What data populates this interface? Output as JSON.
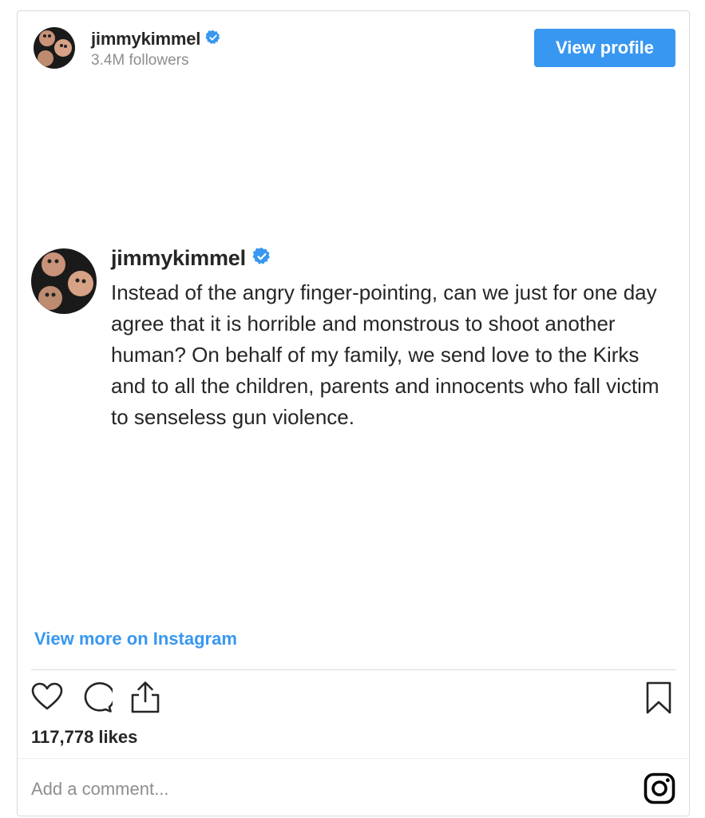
{
  "header": {
    "username": "jimmykimmel",
    "followers": "3.4M followers",
    "view_profile_label": "View profile"
  },
  "post": {
    "username": "jimmykimmel",
    "caption": "Instead of the angry finger-pointing, can we just for one day agree that it is horrible and monstrous to shoot another human? On behalf of my family, we send love to the Kirks and to all the children, parents and innocents who fall victim to senseless gun violence.",
    "view_more_label": "View more on Instagram"
  },
  "actions": {
    "icons": [
      "heart-icon",
      "comment-icon",
      "share-icon",
      "bookmark-icon"
    ],
    "likes": "117,778 likes"
  },
  "comment": {
    "placeholder": "Add a comment..."
  },
  "colors": {
    "accent": "#3897f0",
    "verified": "#3897f0",
    "text": "#262626",
    "muted": "#8e8e8e",
    "border": "#dbdbdb"
  }
}
